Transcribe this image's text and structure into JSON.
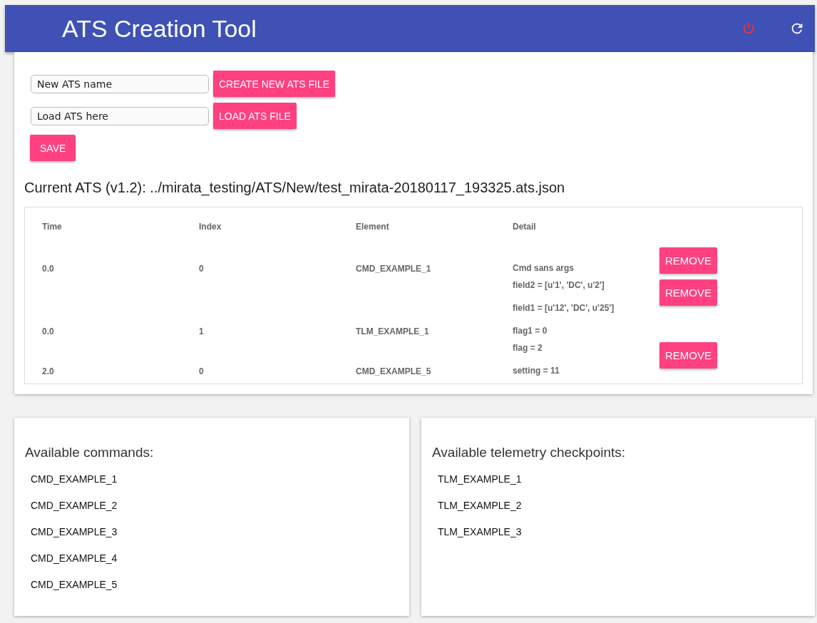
{
  "header": {
    "title": "ATS Creation Tool"
  },
  "controls": [
    {
      "placeholder": "New ATS name",
      "button": "CREATE NEW ATS FILE"
    },
    {
      "placeholder": "Load ATS here",
      "button": "LOAD ATS FILE"
    }
  ],
  "save_button": "SAVE",
  "current_ats": "Current ATS (v1.2): ../mirata_testing/ATS/New/test_mirata-20180117_193325.ats.json",
  "table": {
    "columns": [
      "Time",
      "Index",
      "Element",
      "Detail"
    ],
    "rows": [
      {
        "time": "0.0",
        "index": "0",
        "element": "CMD_EXAMPLE_1",
        "detail": [
          "Cmd sans args"
        ],
        "action": "REMOVE"
      },
      {
        "time": "0.0",
        "index": "1",
        "element": "TLM_EXAMPLE_1",
        "detail": [
          "field2 = [u'1', 'DC', u'2']",
          "field1 = [u'12', 'DC', u'25']",
          "flag1 = 0"
        ],
        "action": "REMOVE"
      },
      {
        "time": "2.0",
        "index": "0",
        "element": "CMD_EXAMPLE_5",
        "detail": [
          "flag = 2",
          "setting = 11"
        ],
        "action": "REMOVE"
      }
    ]
  },
  "panels": [
    {
      "title": "Available commands:",
      "items": [
        "CMD_EXAMPLE_1",
        "CMD_EXAMPLE_2",
        "CMD_EXAMPLE_3",
        "CMD_EXAMPLE_4",
        "CMD_EXAMPLE_5"
      ]
    },
    {
      "title": "Available telemetry checkpoints:",
      "items": [
        "TLM_EXAMPLE_1",
        "TLM_EXAMPLE_2",
        "TLM_EXAMPLE_3"
      ]
    }
  ]
}
